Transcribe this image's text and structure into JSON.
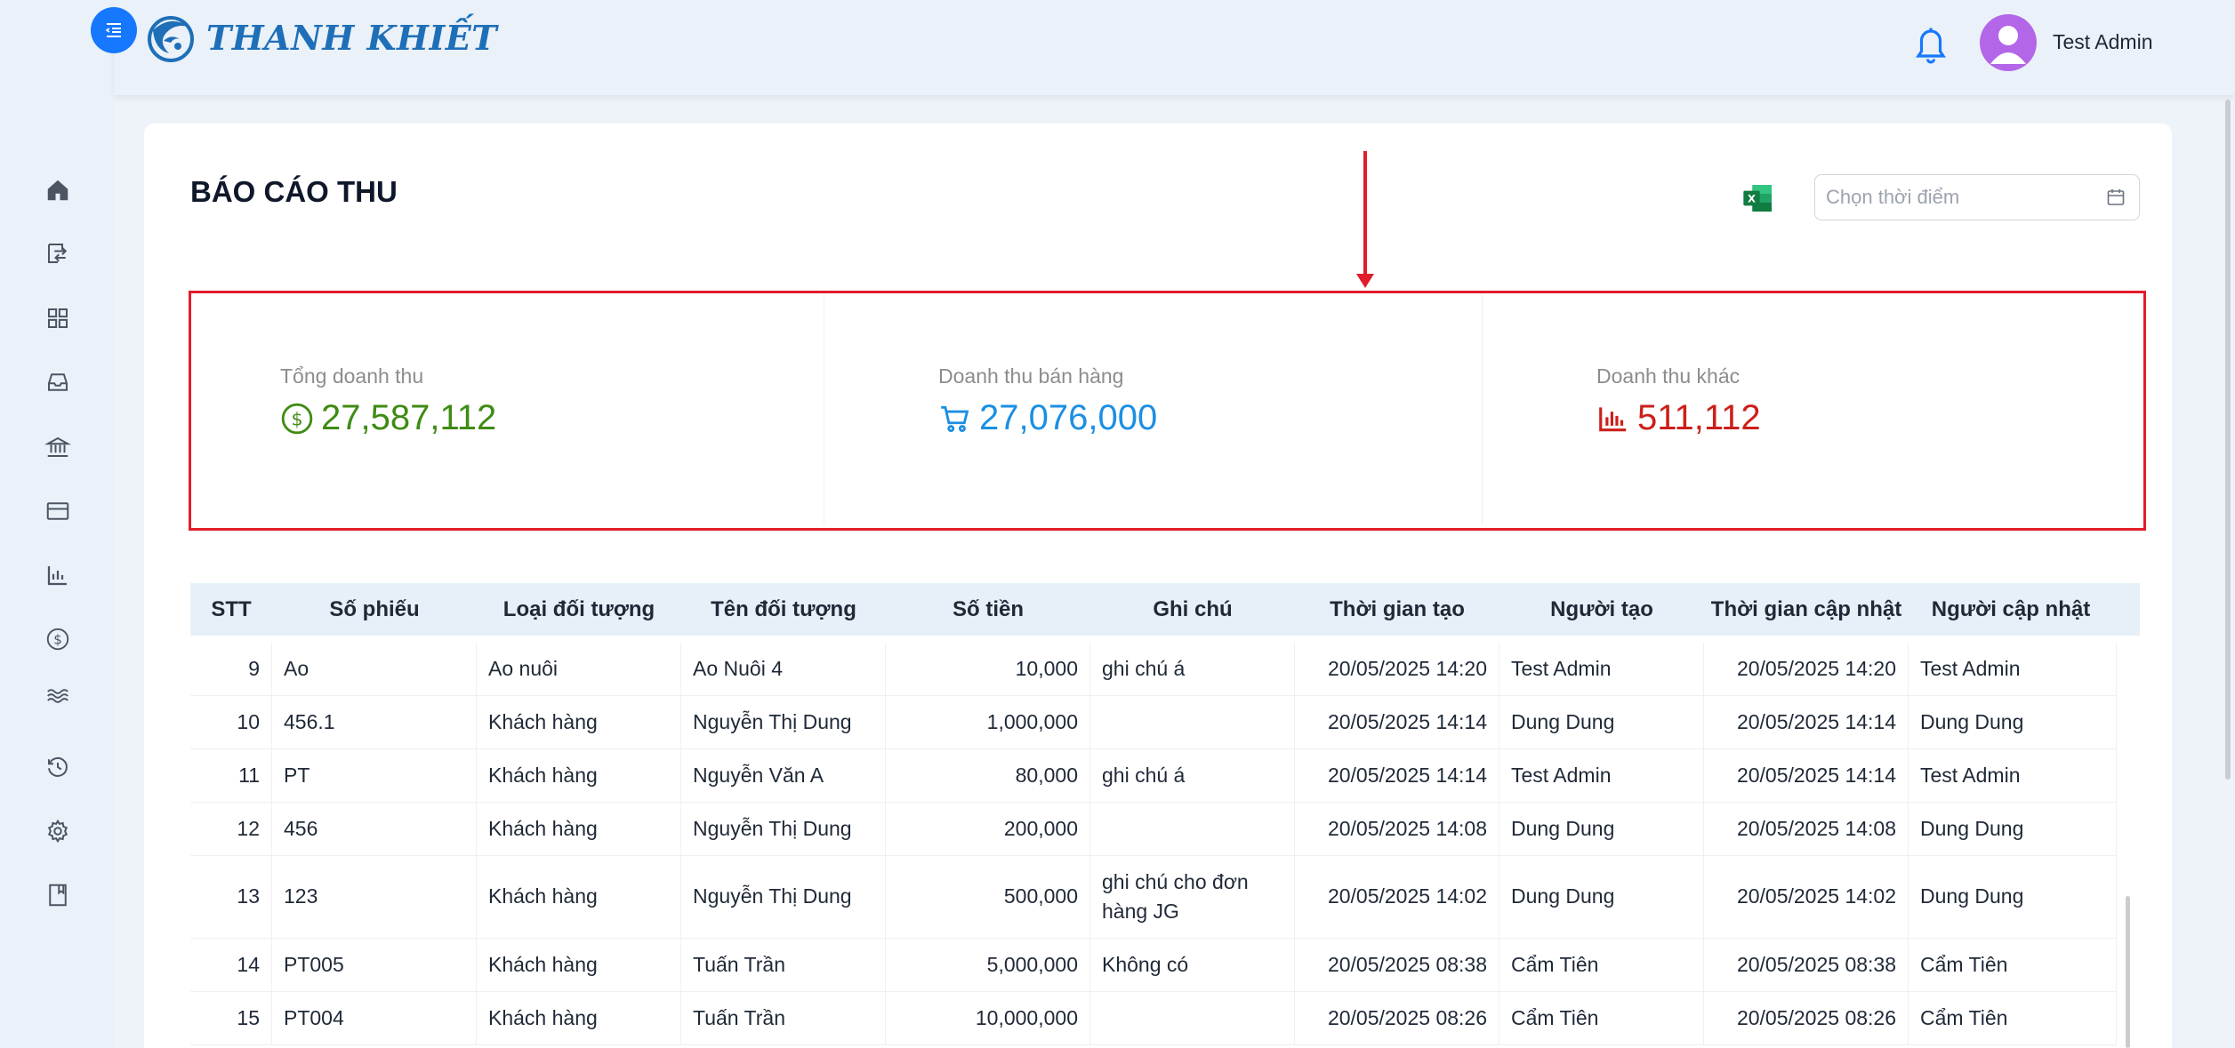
{
  "app": {
    "brand": "THANH KHIẾT",
    "user_name": "Test Admin"
  },
  "sidebar": {
    "icons": [
      "home-icon",
      "transfer-icon",
      "grid-icon",
      "inbox-icon",
      "bank-icon",
      "card-icon",
      "bar-chart-icon",
      "dollar-icon",
      "waves-icon",
      "history-icon",
      "gear-icon",
      "book-icon"
    ]
  },
  "page": {
    "title": "BÁO CÁO THU",
    "date_placeholder": "Chọn thời điểm"
  },
  "stats": [
    {
      "label": "Tổng doanh thu",
      "value": "27,587,112",
      "color": "#3f8b13",
      "icon": "dollar-circle-icon"
    },
    {
      "label": "Doanh thu bán hàng",
      "value": "27,076,000",
      "color": "#1c8fe3",
      "icon": "shopping-cart-icon"
    },
    {
      "label": "Doanh thu khác",
      "value": "511,112",
      "color": "#cc1f1a",
      "icon": "bar-chart-icon"
    }
  ],
  "table": {
    "columns": [
      "STT",
      "Số phiếu",
      "Loại đối tượng",
      "Tên đối tượng",
      "Số tiền",
      "Ghi chú",
      "Thời gian tạo",
      "Người tạo",
      "Thời gian cập nhật",
      "Người cập nhật"
    ],
    "rows": [
      [
        "9",
        "Ao",
        "Ao nuôi",
        "Ao Nuôi 4",
        "10,000",
        "ghi chú á",
        "20/05/2025 14:20",
        "Test Admin",
        "20/05/2025 14:20",
        "Test Admin"
      ],
      [
        "10",
        "456.1",
        "Khách hàng",
        "Nguyễn Thị Dung",
        "1,000,000",
        "",
        "20/05/2025 14:14",
        "Dung Dung",
        "20/05/2025 14:14",
        "Dung Dung"
      ],
      [
        "11",
        "PT",
        "Khách hàng",
        "Nguyễn Văn A",
        "80,000",
        "ghi chú á",
        "20/05/2025 14:14",
        "Test Admin",
        "20/05/2025 14:14",
        "Test Admin"
      ],
      [
        "12",
        "456",
        "Khách hàng",
        "Nguyễn Thị Dung",
        "200,000",
        "",
        "20/05/2025 14:08",
        "Dung Dung",
        "20/05/2025 14:08",
        "Dung Dung"
      ],
      [
        "13",
        "123",
        "Khách hàng",
        "Nguyễn Thị Dung",
        "500,000",
        "ghi chú cho đơn hàng JG",
        "20/05/2025 14:02",
        "Dung Dung",
        "20/05/2025 14:02",
        "Dung Dung"
      ],
      [
        "14",
        "PT005",
        "Khách hàng",
        "Tuấn Trần",
        "5,000,000",
        "Không có",
        "20/05/2025 08:38",
        "Cẩm Tiên",
        "20/05/2025 08:38",
        "Cẩm Tiên"
      ],
      [
        "15",
        "PT004",
        "Khách hàng",
        "Tuấn Trần",
        "10,000,000",
        "",
        "20/05/2025 08:26",
        "Cẩm Tiên",
        "20/05/2025 08:26",
        "Cẩm Tiên"
      ]
    ]
  }
}
